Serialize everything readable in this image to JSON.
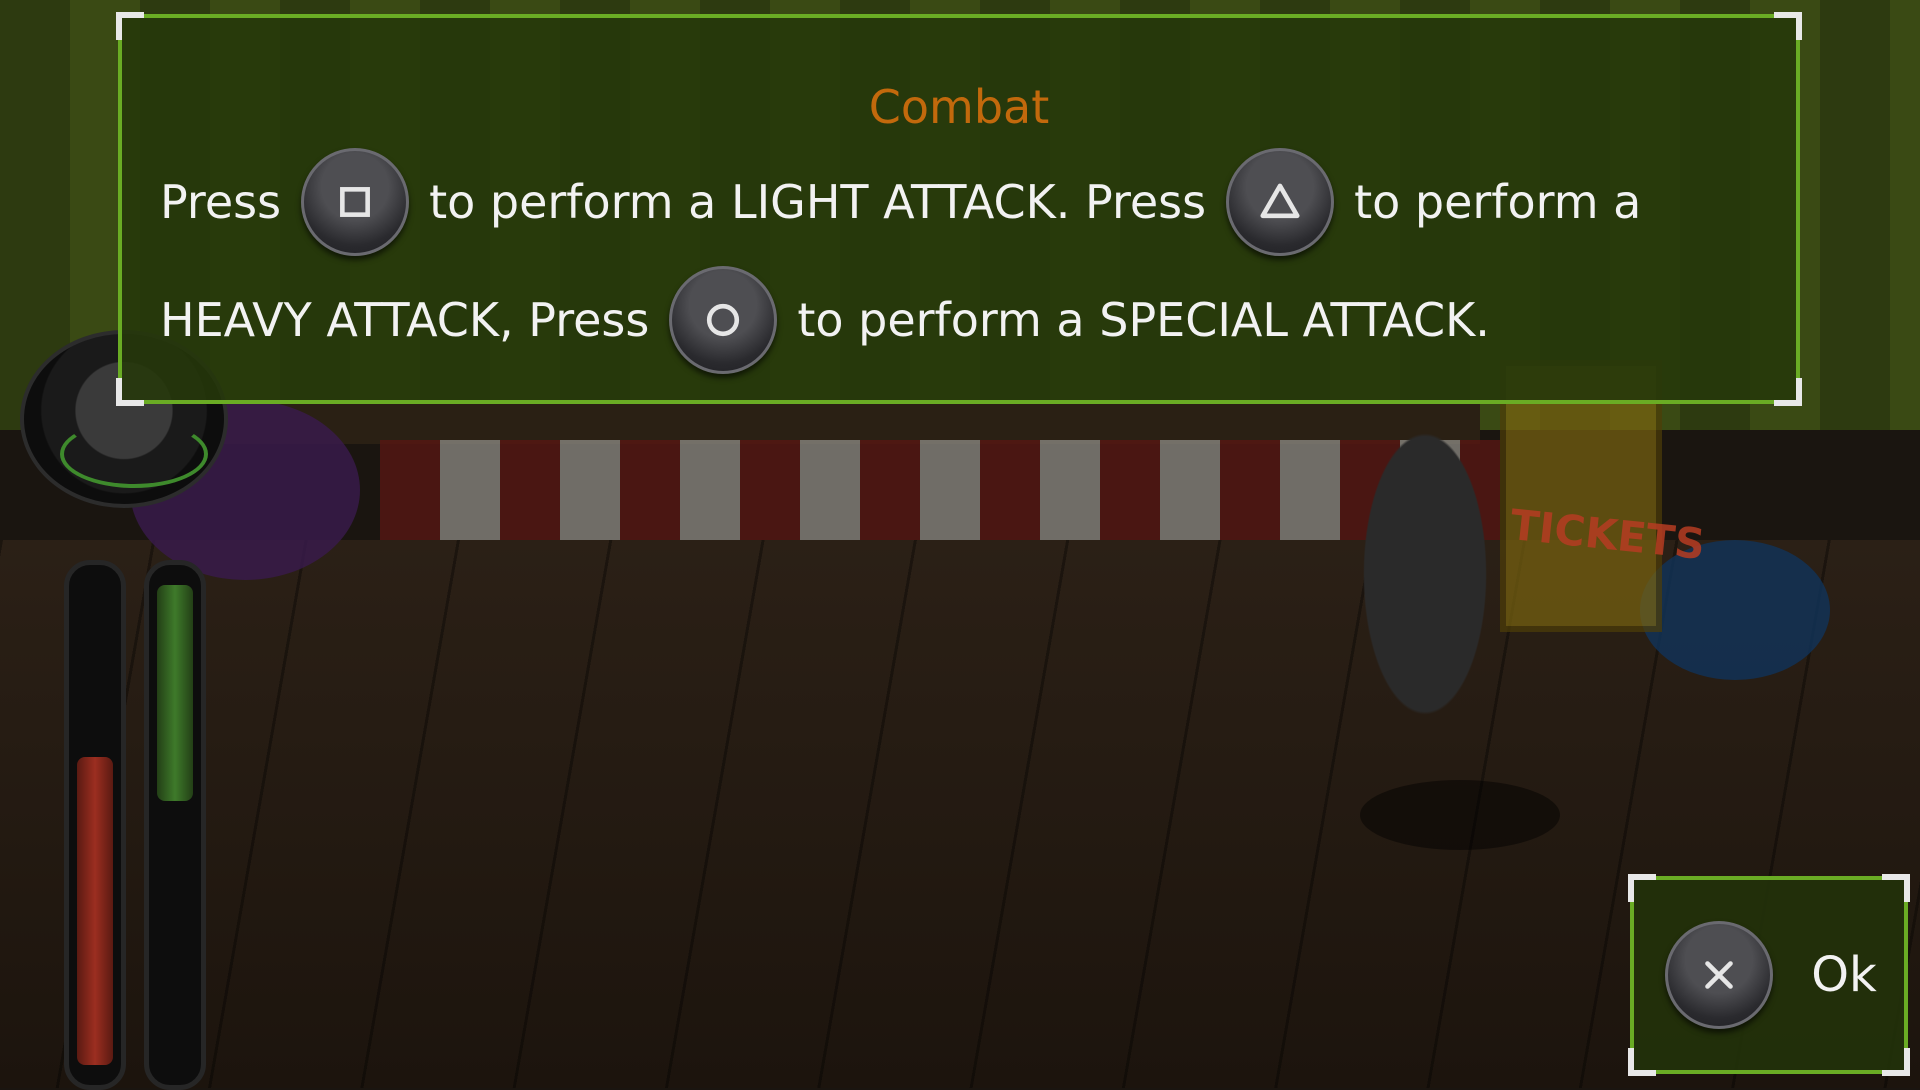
{
  "dialog": {
    "title": "Combat",
    "line1": {
      "press1": "Press",
      "light": "to perform a LIGHT ATTACK. Press",
      "heavy_start": "to perform a"
    },
    "line2": {
      "heavy_end": "HEAVY ATTACK, Press",
      "special": "to perform a SPECIAL ATTACK."
    },
    "buttons": {
      "light": "square-button-icon",
      "heavy": "triangle-button-icon",
      "special": "circle-button-icon"
    }
  },
  "ok": {
    "label": "Ok",
    "icon": "cross-button-icon"
  },
  "scene": {
    "booth_sign": "TICKETS"
  },
  "hud": {
    "health_level": 0.67,
    "energy_level": 0.47
  },
  "colors": {
    "panel_border": "#6aac24",
    "title": "#c2690c",
    "text": "#f2f2f2"
  }
}
